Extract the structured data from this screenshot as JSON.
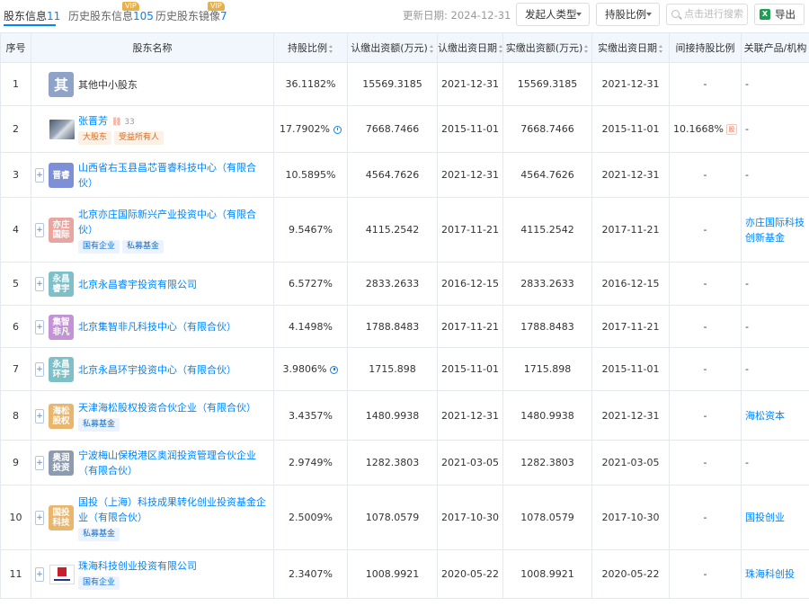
{
  "tabs": [
    {
      "label": "股东信息",
      "count": "11",
      "vip": ""
    },
    {
      "label": "历史股东信息",
      "count": "105",
      "vip": "VIP"
    },
    {
      "label": "历史股东镜像",
      "count": "7",
      "vip": "VIP"
    }
  ],
  "toolbar": {
    "update_label": "更新日期:",
    "update_date": "2024-12-31",
    "filter_type": "发起人类型",
    "filter_ratio": "持股比例",
    "search_placeholder": "点击进行搜索",
    "export_label": "导出",
    "export_icon_text": "X"
  },
  "columns": [
    "序号",
    "股东名称",
    "持股比例",
    "认缴出资额(万元)",
    "认缴出资日期",
    "实缴出资额(万元)",
    "实缴出资日期",
    "间接持股比例",
    "关联产品/机构"
  ],
  "rows": [
    {
      "no": "1",
      "logo": "其",
      "logo_color": "#8fa3c9",
      "name": "其他中小股东",
      "tags": [],
      "pct": "36.1182%",
      "sub_amt": "15569.3185",
      "sub_date": "2021-12-31",
      "paid_amt": "15569.3185",
      "paid_date": "2021-12-31",
      "indirect": "-",
      "related": "-"
    },
    {
      "no": "2",
      "logo": "",
      "logo_color": "",
      "name": "张晋芳",
      "count_badge": "33",
      "tags": [
        "大股东",
        "受益所有人"
      ],
      "pct": "17.7902%",
      "sub_amt": "7668.7466",
      "sub_date": "2015-11-01",
      "paid_amt": "7668.7466",
      "paid_date": "2015-11-01",
      "indirect": "10.1668%",
      "related": "-"
    },
    {
      "no": "3",
      "logo": "晋睿",
      "logo_color": "#7d8fd6",
      "name": "山西省右玉县昌芯晋睿科技中心（有限合伙）",
      "tags": [],
      "pct": "10.5895%",
      "sub_amt": "4564.7626",
      "sub_date": "2021-12-31",
      "paid_amt": "4564.7626",
      "paid_date": "2021-12-31",
      "indirect": "-",
      "related": "-"
    },
    {
      "no": "4",
      "logo": "亦庄\n国际",
      "logo_color": "#e9a6a0",
      "name": "北京亦庄国际新兴产业投资中心（有限合伙）",
      "tags": [
        "国有企业",
        "私募基金"
      ],
      "pct": "9.5467%",
      "sub_amt": "4115.2542",
      "sub_date": "2017-11-21",
      "paid_amt": "4115.2542",
      "paid_date": "2017-11-21",
      "indirect": "-",
      "related": "亦庄国际科技创新基金"
    },
    {
      "no": "5",
      "logo": "永昌\n睿宇",
      "logo_color": "#7fc0c8",
      "name": "北京永昌睿宇投资有限公司",
      "tags": [],
      "pct": "6.5727%",
      "sub_amt": "2833.2633",
      "sub_date": "2016-12-15",
      "paid_amt": "2833.2633",
      "paid_date": "2016-12-15",
      "indirect": "-",
      "related": "-"
    },
    {
      "no": "6",
      "logo": "集智\n非凡",
      "logo_color": "#c493d6",
      "name": "北京集智非凡科技中心（有限合伙）",
      "tags": [],
      "pct": "4.1498%",
      "sub_amt": "1788.8483",
      "sub_date": "2017-11-21",
      "paid_amt": "1788.8483",
      "paid_date": "2017-11-21",
      "indirect": "-",
      "related": "-"
    },
    {
      "no": "7",
      "logo": "永昌\n环宇",
      "logo_color": "#7fc0c8",
      "name": "北京永昌环宇投资中心（有限合伙）",
      "tags": [],
      "pct": "3.9806%",
      "sub_amt": "1715.898",
      "sub_date": "2015-11-01",
      "paid_amt": "1715.898",
      "paid_date": "2015-11-01",
      "indirect": "-",
      "related": "-"
    },
    {
      "no": "8",
      "logo": "海松\n股权",
      "logo_color": "#e9b66e",
      "name": "天津海松股权投资合伙企业（有限合伙）",
      "tags": [
        "私募基金"
      ],
      "pct": "3.4357%",
      "sub_amt": "1480.9938",
      "sub_date": "2021-12-31",
      "paid_amt": "1480.9938",
      "paid_date": "2021-12-31",
      "indirect": "-",
      "related": "海松资本"
    },
    {
      "no": "9",
      "logo": "奥润\n投资",
      "logo_color": "#8c9bb0",
      "name": "宁波梅山保税港区奥润投资管理合伙企业（有限合伙）",
      "tags": [],
      "pct": "2.9749%",
      "sub_amt": "1282.3803",
      "sub_date": "2021-03-05",
      "paid_amt": "1282.3803",
      "paid_date": "2021-03-05",
      "indirect": "-",
      "related": "-"
    },
    {
      "no": "10",
      "logo": "国投\n科技",
      "logo_color": "#e9b66e",
      "name": "国投（上海）科技成果转化创业投资基金企业（有限合伙）",
      "tags": [
        "私募基金"
      ],
      "pct": "2.5009%",
      "sub_amt": "1078.0579",
      "sub_date": "2017-10-30",
      "paid_amt": "1078.0579",
      "paid_date": "2017-10-30",
      "indirect": "-",
      "related": "国投创业"
    },
    {
      "no": "11",
      "logo": "",
      "logo_color": "",
      "name": "珠海科技创业投资有限公司",
      "tags": [
        "国有企业"
      ],
      "pct": "2.3407%",
      "sub_amt": "1008.9921",
      "sub_date": "2020-05-22",
      "paid_amt": "1008.9921",
      "paid_date": "2020-05-22",
      "indirect": "-",
      "related": "珠海科创投"
    }
  ],
  "icons": {
    "pie": "pie-chart-icon",
    "chain": "equity-chain-icon",
    "search": "search-icon",
    "excel": "excel-icon"
  }
}
